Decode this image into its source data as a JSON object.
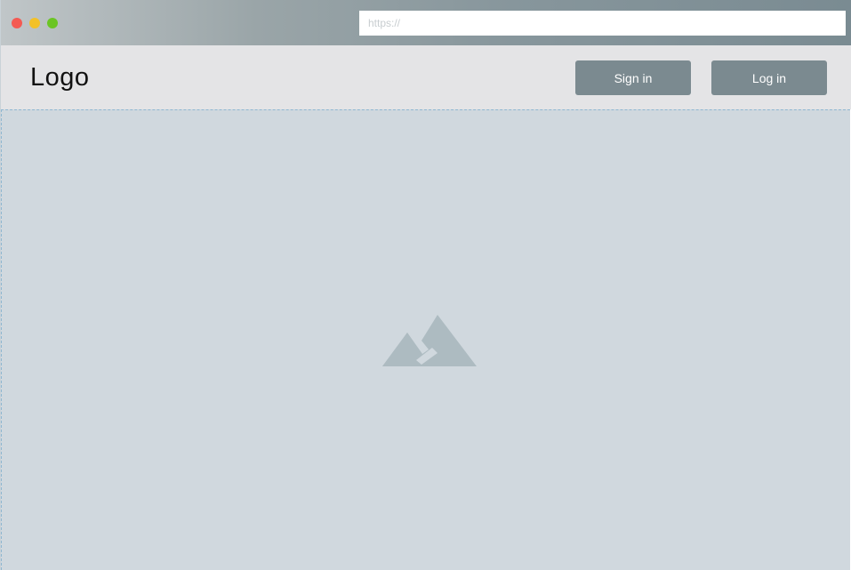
{
  "browser": {
    "window_controls": [
      "close",
      "minimize",
      "maximize"
    ],
    "url_placeholder": "https://",
    "url_value": ""
  },
  "header": {
    "logo_text": "Logo",
    "signin_label": "Sign in",
    "login_label": "Log in"
  },
  "hero": {
    "icon": "image-placeholder-icon"
  },
  "colors": {
    "header_bg": "#e4e4e6",
    "button_bg": "#7b8a90",
    "hero_bg": "#d0d8de",
    "icon_color": "#adbbc1"
  }
}
